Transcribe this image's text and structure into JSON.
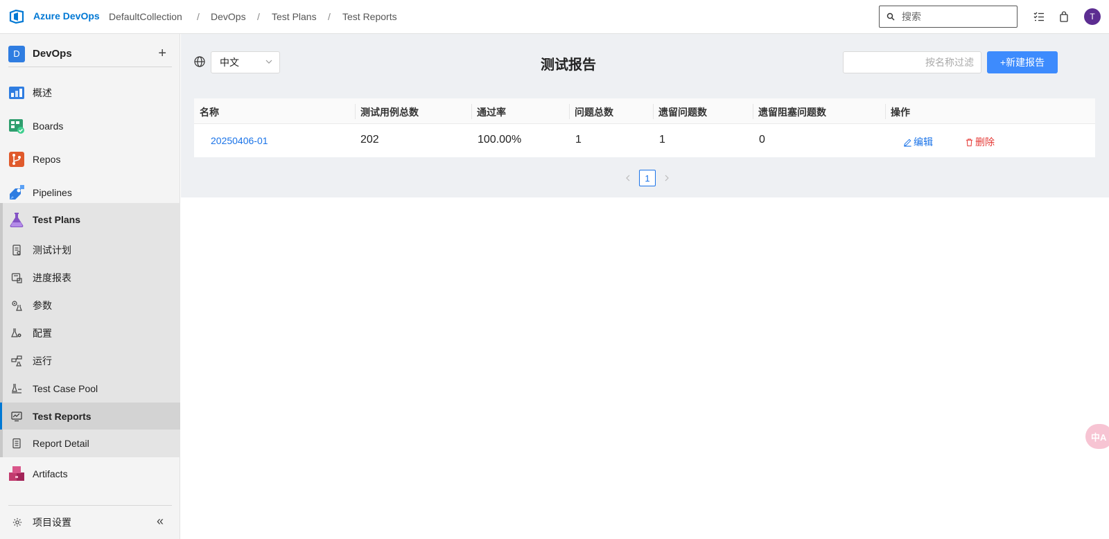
{
  "topbar": {
    "brand": "Azure DevOps",
    "breadcrumbs": [
      "DefaultCollection",
      "DevOps",
      "Test Plans",
      "Test Reports"
    ],
    "separator": "/",
    "search_placeholder": "搜索",
    "avatar_initial": "T"
  },
  "sidebar": {
    "project_badge": "D",
    "project_name": "DevOps",
    "add_label": "+",
    "items": [
      {
        "label": "概述",
        "icon": "overview-icon"
      },
      {
        "label": "Boards",
        "icon": "boards-icon"
      },
      {
        "label": "Repos",
        "icon": "repos-icon"
      },
      {
        "label": "Pipelines",
        "icon": "pipelines-icon"
      },
      {
        "label": "Test Plans",
        "icon": "test-plans-icon"
      },
      {
        "label": "测试计划",
        "icon": "test-plan-icon"
      },
      {
        "label": "进度报表",
        "icon": "progress-report-icon"
      },
      {
        "label": "参数",
        "icon": "parameters-icon"
      },
      {
        "label": "配置",
        "icon": "configuration-icon"
      },
      {
        "label": "运行",
        "icon": "runs-icon"
      },
      {
        "label": "Test Case Pool",
        "icon": "test-case-pool-icon"
      },
      {
        "label": "Test Reports",
        "icon": "test-reports-icon"
      },
      {
        "label": "Report Detail",
        "icon": "report-detail-icon"
      },
      {
        "label": "Artifacts",
        "icon": "artifacts-icon"
      }
    ],
    "settings_label": "项目设置",
    "collapse_label": "«"
  },
  "main": {
    "language": "中文",
    "title": "测试报告",
    "filter_placeholder": "按名称过滤",
    "new_report_label": "+新建报告",
    "table": {
      "headers": [
        "名称",
        "测试用例总数",
        "通过率",
        "问题总数",
        "遗留问题数",
        "遗留阻塞问题数",
        "操作"
      ],
      "rows": [
        {
          "name": "20250406-01",
          "total_cases": "202",
          "pass_rate": "100.00%",
          "issues": "1",
          "remaining": "1",
          "remaining_blocking": "0",
          "edit": "编辑",
          "delete": "删除"
        }
      ]
    },
    "pagination": {
      "current_page": "1"
    }
  },
  "float_button": {
    "label": "中A"
  },
  "colors": {
    "accent": "#0078d4",
    "primary_button": "#3d8bfd",
    "link": "#1a73e8",
    "danger": "#e53935",
    "avatar": "#5c2d91"
  }
}
